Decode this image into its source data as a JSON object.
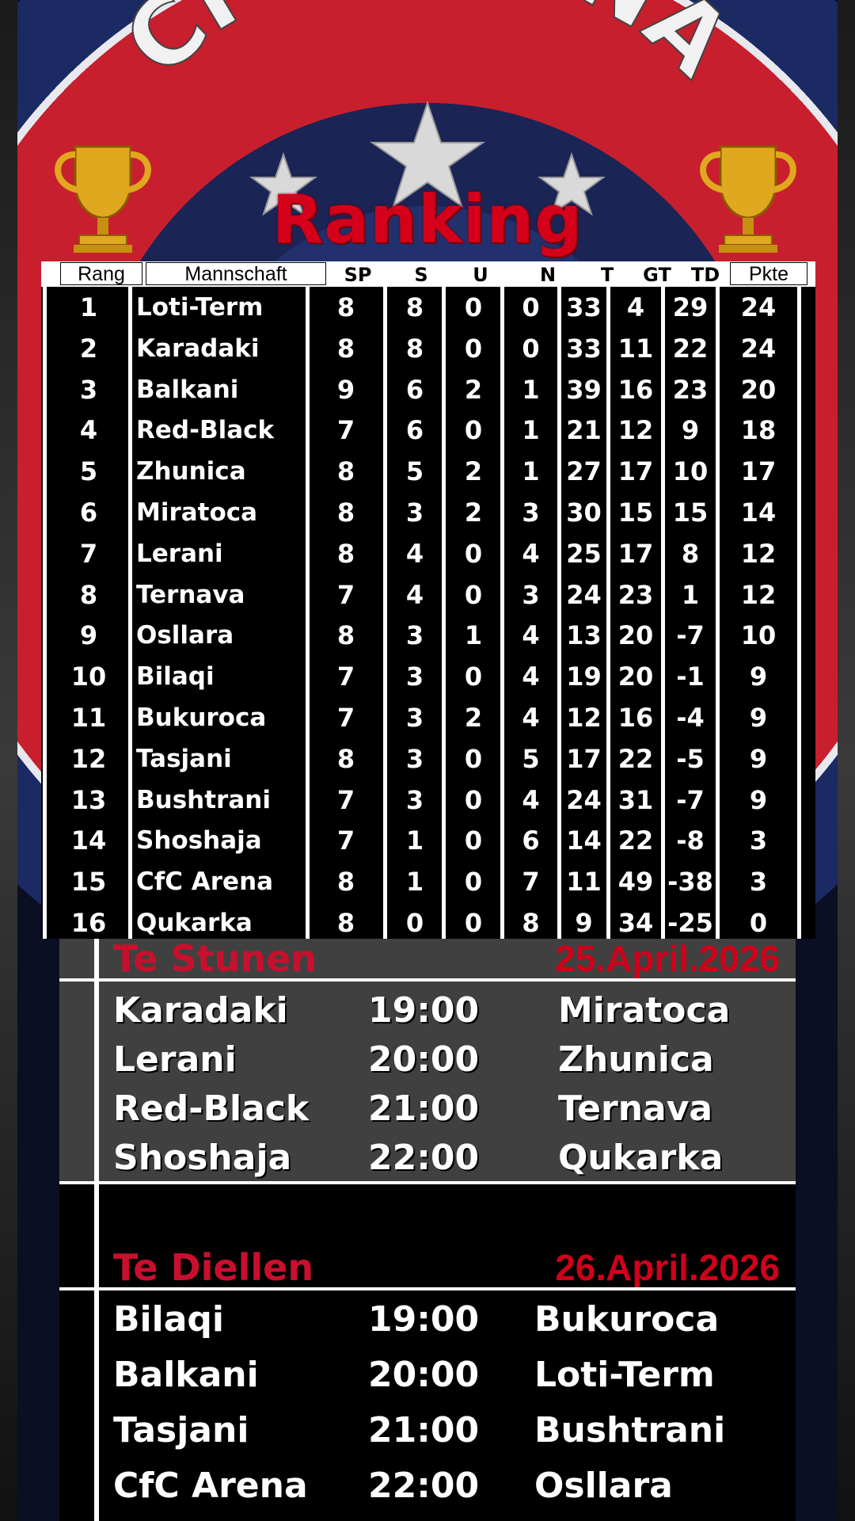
{
  "banner": {
    "club_text": "CFC ARENA",
    "title": "Ranking"
  },
  "colors": {
    "title_red": "#d4001a",
    "logo_red": "#c71f2e",
    "logo_blue": "#1b2a63"
  },
  "icons": [
    "trophy-icon",
    "star-icon"
  ],
  "table": {
    "headers": {
      "rank": "Rang",
      "team": "Mannschaft",
      "played": "SP",
      "wins": "S",
      "draws": "U",
      "losses": "N",
      "goals_for": "T",
      "goals_against": "GT",
      "goal_diff": "TD",
      "points": "Pkte"
    },
    "rows": [
      {
        "rank": "1",
        "team": "Loti-Term",
        "sp": "8",
        "s": "8",
        "u": "0",
        "n": "0",
        "t": "33",
        "gt": "4",
        "td": "29",
        "pkte": "24"
      },
      {
        "rank": "2",
        "team": "Karadaki",
        "sp": "8",
        "s": "8",
        "u": "0",
        "n": "0",
        "t": "33",
        "gt": "11",
        "td": "22",
        "pkte": "24"
      },
      {
        "rank": "3",
        "team": "Balkani",
        "sp": "9",
        "s": "6",
        "u": "2",
        "n": "1",
        "t": "39",
        "gt": "16",
        "td": "23",
        "pkte": "20"
      },
      {
        "rank": "4",
        "team": "Red-Black",
        "sp": "7",
        "s": "6",
        "u": "0",
        "n": "1",
        "t": "21",
        "gt": "12",
        "td": "9",
        "pkte": "18"
      },
      {
        "rank": "5",
        "team": "Zhunica",
        "sp": "8",
        "s": "5",
        "u": "2",
        "n": "1",
        "t": "27",
        "gt": "17",
        "td": "10",
        "pkte": "17"
      },
      {
        "rank": "6",
        "team": "Miratoca",
        "sp": "8",
        "s": "3",
        "u": "2",
        "n": "3",
        "t": "30",
        "gt": "15",
        "td": "15",
        "pkte": "14"
      },
      {
        "rank": "7",
        "team": "Lerani",
        "sp": "8",
        "s": "4",
        "u": "0",
        "n": "4",
        "t": "25",
        "gt": "17",
        "td": "8",
        "pkte": "12"
      },
      {
        "rank": "8",
        "team": "Ternava",
        "sp": "7",
        "s": "4",
        "u": "0",
        "n": "3",
        "t": "24",
        "gt": "23",
        "td": "1",
        "pkte": "12"
      },
      {
        "rank": "9",
        "team": "Osllara",
        "sp": "8",
        "s": "3",
        "u": "1",
        "n": "4",
        "t": "13",
        "gt": "20",
        "td": "-7",
        "pkte": "10"
      },
      {
        "rank": "10",
        "team": "Bilaqi",
        "sp": "7",
        "s": "3",
        "u": "0",
        "n": "4",
        "t": "19",
        "gt": "20",
        "td": "-1",
        "pkte": "9"
      },
      {
        "rank": "11",
        "team": "Bukuroca",
        "sp": "7",
        "s": "3",
        "u": "2",
        "n": "4",
        "t": "12",
        "gt": "16",
        "td": "-4",
        "pkte": "9"
      },
      {
        "rank": "12",
        "team": "Tasjani",
        "sp": "8",
        "s": "3",
        "u": "0",
        "n": "5",
        "t": "17",
        "gt": "22",
        "td": "-5",
        "pkte": "9"
      },
      {
        "rank": "13",
        "team": "Bushtrani",
        "sp": "7",
        "s": "3",
        "u": "0",
        "n": "4",
        "t": "24",
        "gt": "31",
        "td": "-7",
        "pkte": "9"
      },
      {
        "rank": "14",
        "team": "Shoshaja",
        "sp": "7",
        "s": "1",
        "u": "0",
        "n": "6",
        "t": "14",
        "gt": "22",
        "td": "-8",
        "pkte": "3"
      },
      {
        "rank": "15",
        "team": "CfC Arena",
        "sp": "8",
        "s": "1",
        "u": "0",
        "n": "7",
        "t": "11",
        "gt": "49",
        "td": "-38",
        "pkte": "3"
      },
      {
        "rank": "16",
        "team": "Qukarka",
        "sp": "8",
        "s": "0",
        "u": "0",
        "n": "8",
        "t": "9",
        "gt": "34",
        "td": "-25",
        "pkte": "0"
      }
    ]
  },
  "fixtures": [
    {
      "day": "Te Stunen",
      "date": "25.April.2026",
      "matches": [
        {
          "home": "Karadaki",
          "time": "19:00",
          "away": "Miratoca"
        },
        {
          "home": "Lerani",
          "time": "20:00",
          "away": "Zhunica"
        },
        {
          "home": "Red-Black",
          "time": "21:00",
          "away": "Ternava"
        },
        {
          "home": "Shoshaja",
          "time": "22:00",
          "away": "Qukarka"
        }
      ]
    },
    {
      "day": "Te Diellen",
      "date": "26.April.2026",
      "matches": [
        {
          "home": "Bilaqi",
          "time": "19:00",
          "away": "Bukuroca"
        },
        {
          "home": "Balkani",
          "time": "20:00",
          "away": "Loti-Term"
        },
        {
          "home": "Tasjani",
          "time": "21:00",
          "away": "Bushtrani"
        },
        {
          "home": "CfC Arena",
          "time": "22:00",
          "away": "Osllara"
        }
      ]
    }
  ]
}
